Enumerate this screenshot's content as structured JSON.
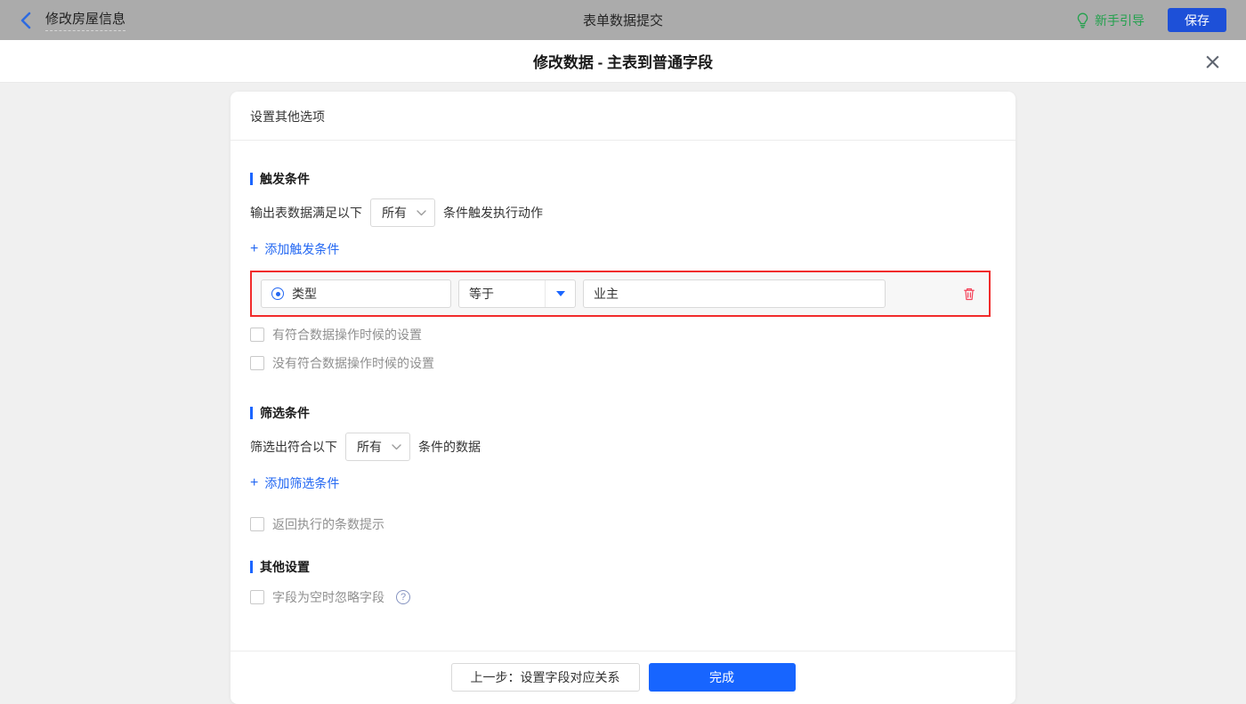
{
  "topbar": {
    "back_label": "修改房屋信息",
    "center_title": "表单数据提交",
    "guide_label": "新手引导",
    "save_label": "保存"
  },
  "modal": {
    "title": "修改数据 - 主表到普通字段"
  },
  "card": {
    "header": "设置其他选项"
  },
  "trigger": {
    "title": "触发条件",
    "prefix": "输出表数据满足以下",
    "match_mode": "所有",
    "suffix": "条件触发执行动作",
    "add_label": "添加触发条件",
    "checkboxes": [
      "有符合数据操作时候的设置",
      "没有符合数据操作时候的设置"
    ]
  },
  "condition": {
    "field": "类型",
    "operator": "等于",
    "value": "业主"
  },
  "filter": {
    "title": "筛选条件",
    "prefix": "筛选出符合以下",
    "match_mode": "所有",
    "suffix": "条件的数据",
    "add_label": "添加筛选条件",
    "checkbox": "返回执行的条数提示"
  },
  "other": {
    "title": "其他设置",
    "checkbox": "字段为空时忽略字段"
  },
  "footer": {
    "prev_label": "上一步：设置字段对应关系",
    "done_label": "完成"
  },
  "icons": {
    "plus": "+",
    "close": "×",
    "question": "?"
  },
  "colors": {
    "accent": "#1b66ff",
    "link": "#2468f2",
    "danger": "#f12b2b",
    "success": "#23a14d",
    "topbar_bg": "#ababab"
  }
}
